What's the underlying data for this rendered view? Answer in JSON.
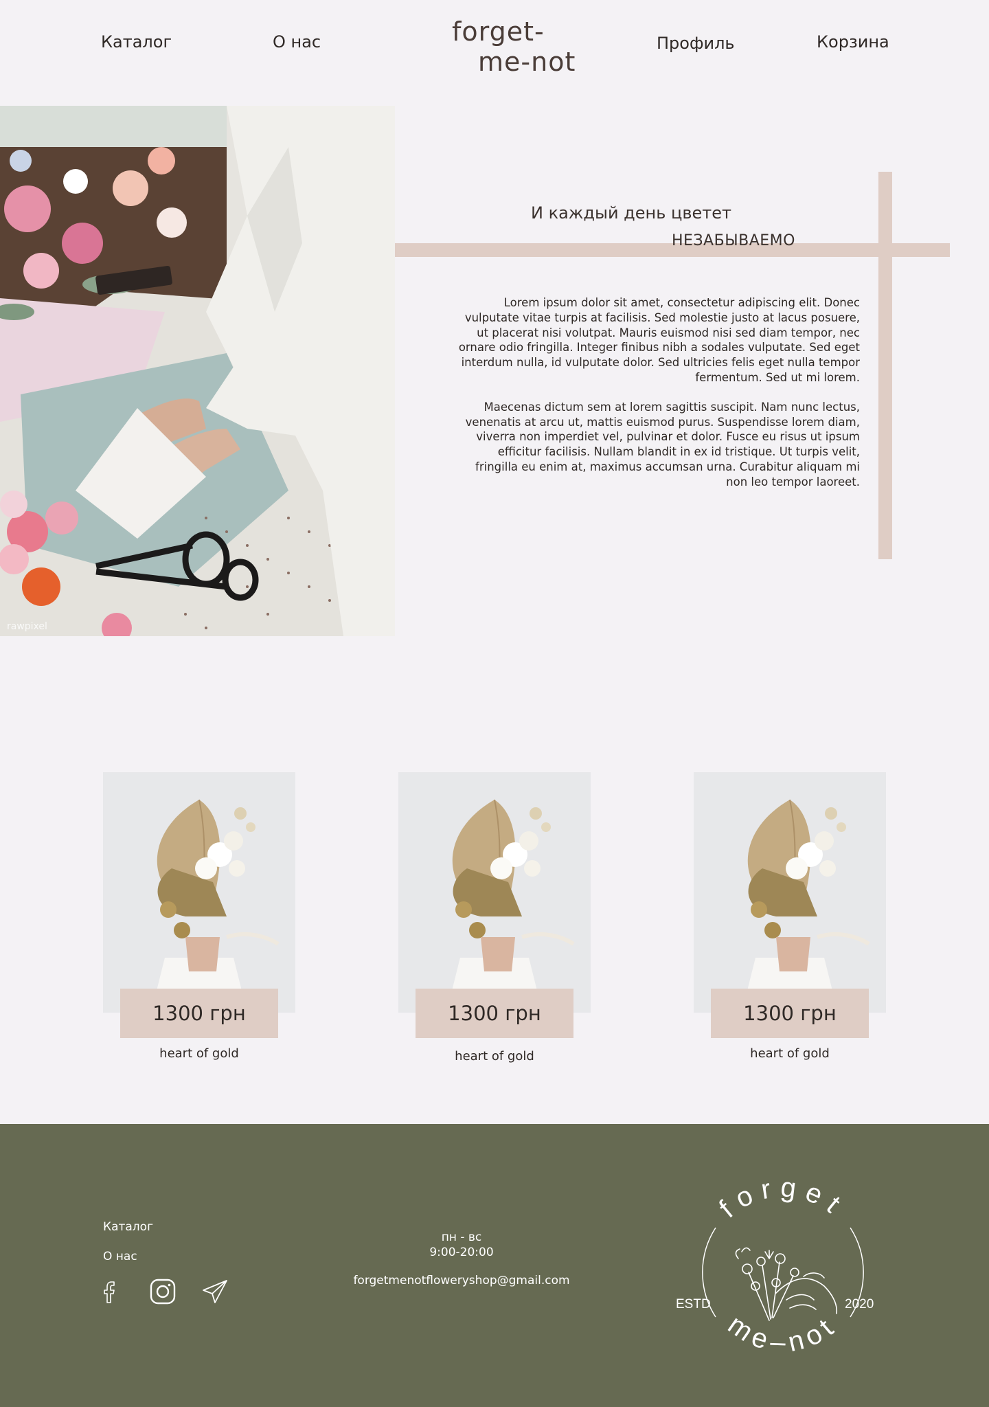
{
  "header": {
    "nav_left": [
      "Каталог",
      "О нас"
    ],
    "nav_right": [
      "Профиль",
      "Корзина"
    ],
    "logo_line1": "forget-",
    "logo_line2": "me-not"
  },
  "hero": {
    "tagline_line1": "И каждый день цветет",
    "tagline_line2": "НЕЗАБЫВАЕМО",
    "paragraph1": "Lorem ipsum dolor sit amet, consectetur adipiscing elit. Donec vulputate vitae turpis at facilisis. Sed molestie justo at lacus posuere, ut placerat nisi volutpat. Mauris euismod nisi sed diam tempor, nec ornare odio fringilla. Integer finibus nibh a sodales vulputate. Sed eget interdum nulla, id vulputate dolor. Sed ultricies felis eget nulla tempor fermentum. Sed ut mi lorem.",
    "paragraph2": "Maecenas dictum sem at lorem sagittis suscipit. Nam nunc lectus, venenatis at arcu ut, mattis euismod purus. Suspendisse lorem diam, viverra non imperdiet vel, pulvinar et dolor. Fusce eu risus ut ipsum efficitur facilisis. Nullam blandit in ex id tristique. Ut turpis velit, fringilla eu enim at, maximus accumsan urna. Curabitur aliquam mi non leo tempor laoreet.",
    "photo_watermark": "rawpixel"
  },
  "products": [
    {
      "price": "1300 грн",
      "name": "heart of gold"
    },
    {
      "price": "1300 грн",
      "name": "heart of gold"
    },
    {
      "price": "1300 грн",
      "name": "heart of gold"
    }
  ],
  "footer": {
    "links": [
      "Каталог",
      "О нас"
    ],
    "social_icons": [
      "facebook-icon",
      "instagram-icon",
      "telegram-icon"
    ],
    "hours_days": "пн - вс",
    "hours_time": "9:00-20:00",
    "email": "forgetmenotfloweryshop@gmail.com",
    "badge_top": "forget",
    "badge_bottom": "me–not",
    "badge_left": "ESTD",
    "badge_right": "2020"
  },
  "colors": {
    "background": "#f4f2f5",
    "accent": "#dfcdc5",
    "footer": "#666a52",
    "text": "#2f2926"
  }
}
